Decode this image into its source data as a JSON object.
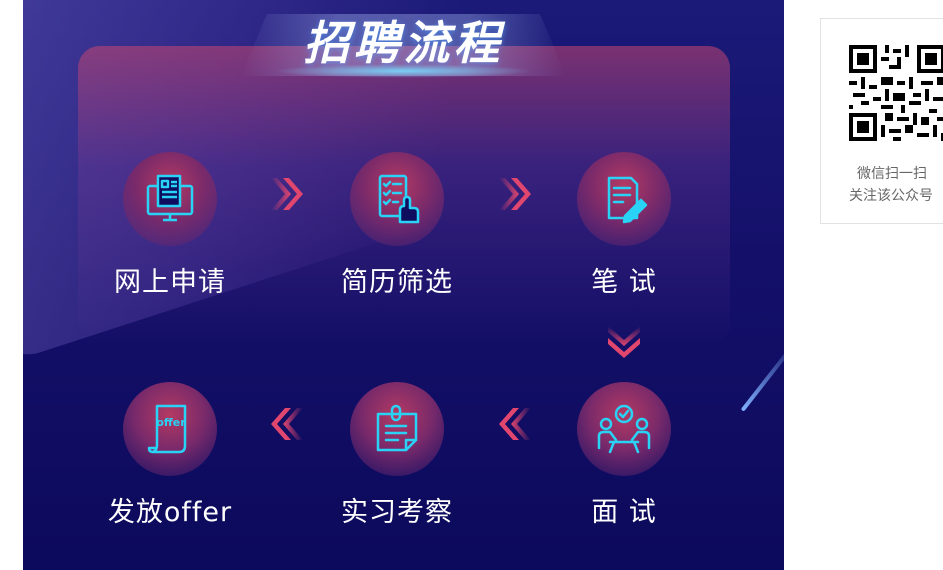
{
  "banner": {
    "title": "招聘流程",
    "steps": [
      {
        "label": "网上申请",
        "icon": "computer-form-icon"
      },
      {
        "label": "简历筛选",
        "icon": "checklist-hand-icon"
      },
      {
        "label": "笔 试",
        "icon": "document-pen-icon"
      },
      {
        "label": "面 试",
        "icon": "interview-people-icon"
      },
      {
        "label": "实习考察",
        "icon": "clipboard-note-icon"
      },
      {
        "label": "发放offer",
        "icon": "offer-scroll-icon"
      }
    ],
    "offer_icon_text": "offer",
    "colors": {
      "accent_cyan": "#29d3f5",
      "accent_pink": "#e0466e",
      "bg_navy": "#14106a"
    }
  },
  "qr": {
    "line1": "微信扫一扫",
    "line2": "关注该公众号"
  }
}
